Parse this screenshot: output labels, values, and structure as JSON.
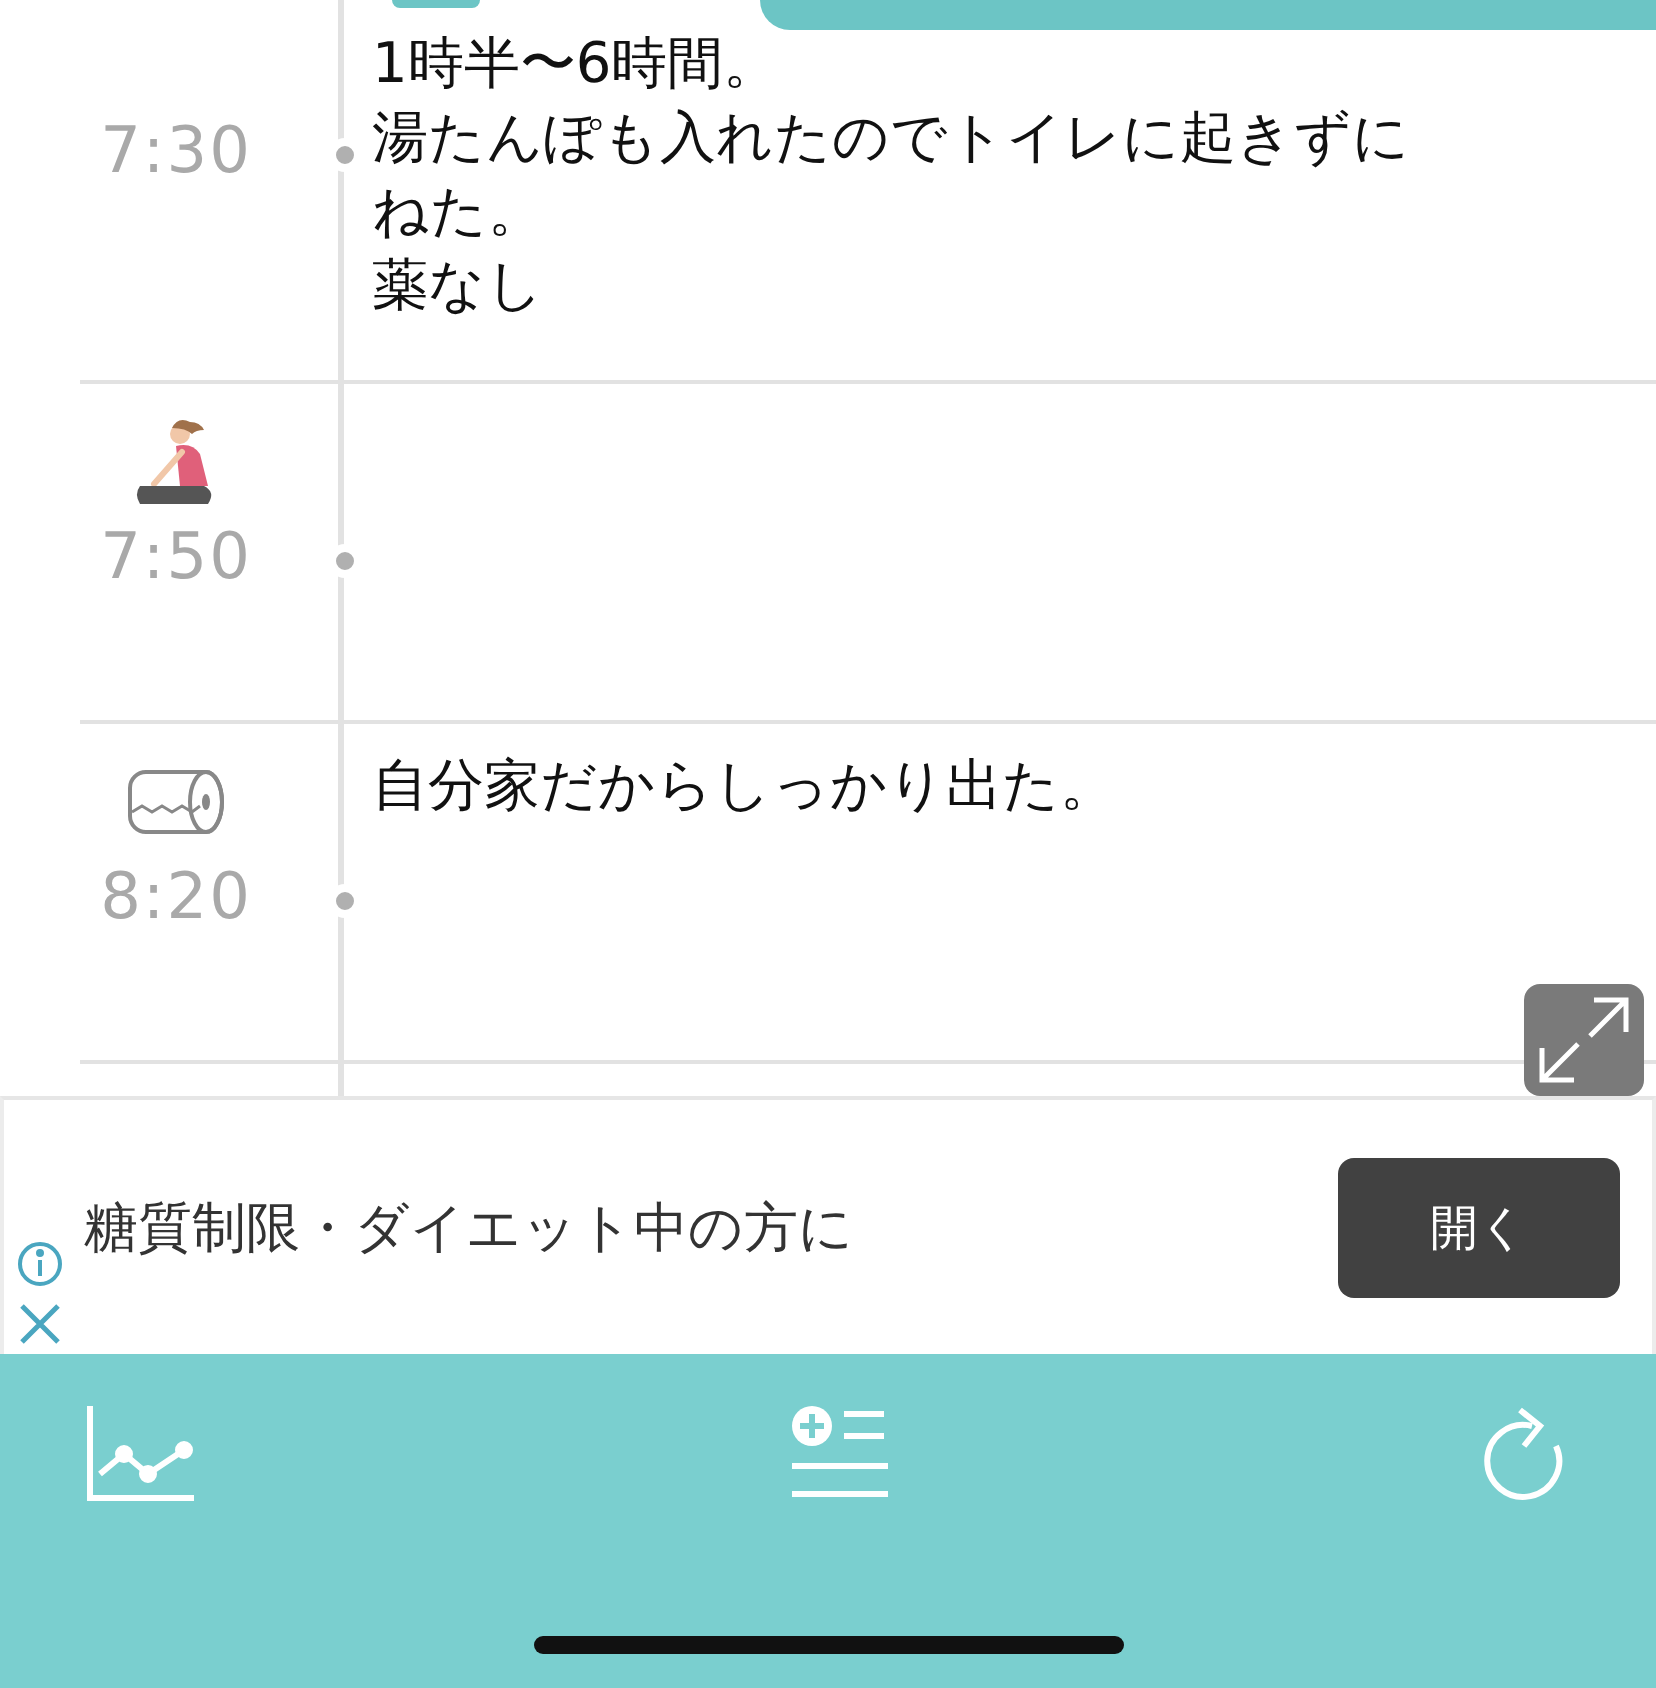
{
  "entries": [
    {
      "time": "7:30",
      "kind": "plain",
      "note": [
        "1時半〜6時間。",
        "湯たんぽも入れたのでトイレに起きずにねた。",
        "薬なし"
      ]
    },
    {
      "time": "7:50",
      "kind": "stretch"
    },
    {
      "time": "8:20",
      "kind": "toilet",
      "note": [
        "自分家だからしっかり出た。"
      ]
    }
  ],
  "ad": {
    "text": "糖質制限・ダイエット中の方に",
    "button": "開く"
  },
  "tab_bar": [
    {
      "kind": "chart"
    },
    {
      "kind": "add-record"
    },
    {
      "kind": "refresh"
    }
  ]
}
